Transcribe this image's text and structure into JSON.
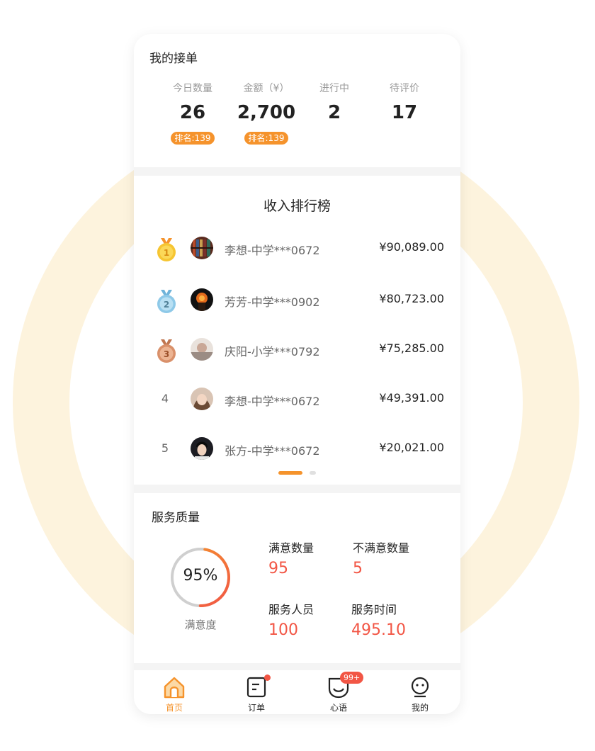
{
  "orders": {
    "title": "我的接单",
    "stats": [
      {
        "label": "今日数量",
        "value": "26",
        "badge": "排名:139"
      },
      {
        "label": "金额（¥）",
        "value": "2,700",
        "badge": "排名:139"
      },
      {
        "label": "进行中",
        "value": "2"
      },
      {
        "label": "待评价",
        "value": "17"
      }
    ]
  },
  "ranking": {
    "title": "收入排行榜",
    "rows": [
      {
        "rank": "1",
        "name": "李想-中学***0672",
        "amount": "¥90,089.00"
      },
      {
        "rank": "2",
        "name": "芳芳-中学***0902",
        "amount": "¥80,723.00"
      },
      {
        "rank": "3",
        "name": "庆阳-小学***0792",
        "amount": "¥75,285.00"
      },
      {
        "rank": "4",
        "name": "李想-中学***0672",
        "amount": "¥49,391.00"
      },
      {
        "rank": "5",
        "name": "张方-中学***0672",
        "amount": "¥20,021.00"
      }
    ],
    "page_indicator": {
      "current": 1,
      "total": 2
    }
  },
  "quality": {
    "title": "服务质量",
    "satisfaction": {
      "percent_text": "95%",
      "label": "满意度",
      "fraction": 0.95
    },
    "items": [
      {
        "label": "满意数量",
        "value": "95"
      },
      {
        "label": "不满意数量",
        "value": "5"
      },
      {
        "label": "服务人员",
        "value": "100"
      },
      {
        "label": "服务时间",
        "value": "495.10"
      }
    ]
  },
  "tabbar": {
    "tabs": [
      {
        "label": "首页",
        "icon": "home-icon",
        "active": true
      },
      {
        "label": "订单",
        "icon": "order-icon",
        "dot": true
      },
      {
        "label": "心语",
        "icon": "message-icon",
        "badge": "99+"
      },
      {
        "label": "我的",
        "icon": "profile-icon"
      }
    ]
  },
  "colors": {
    "accent": "#f5932c",
    "value_red": "#f25645",
    "gold": "#f6c531",
    "silver": "#8ec9e8",
    "bronze": "#d9906a"
  }
}
